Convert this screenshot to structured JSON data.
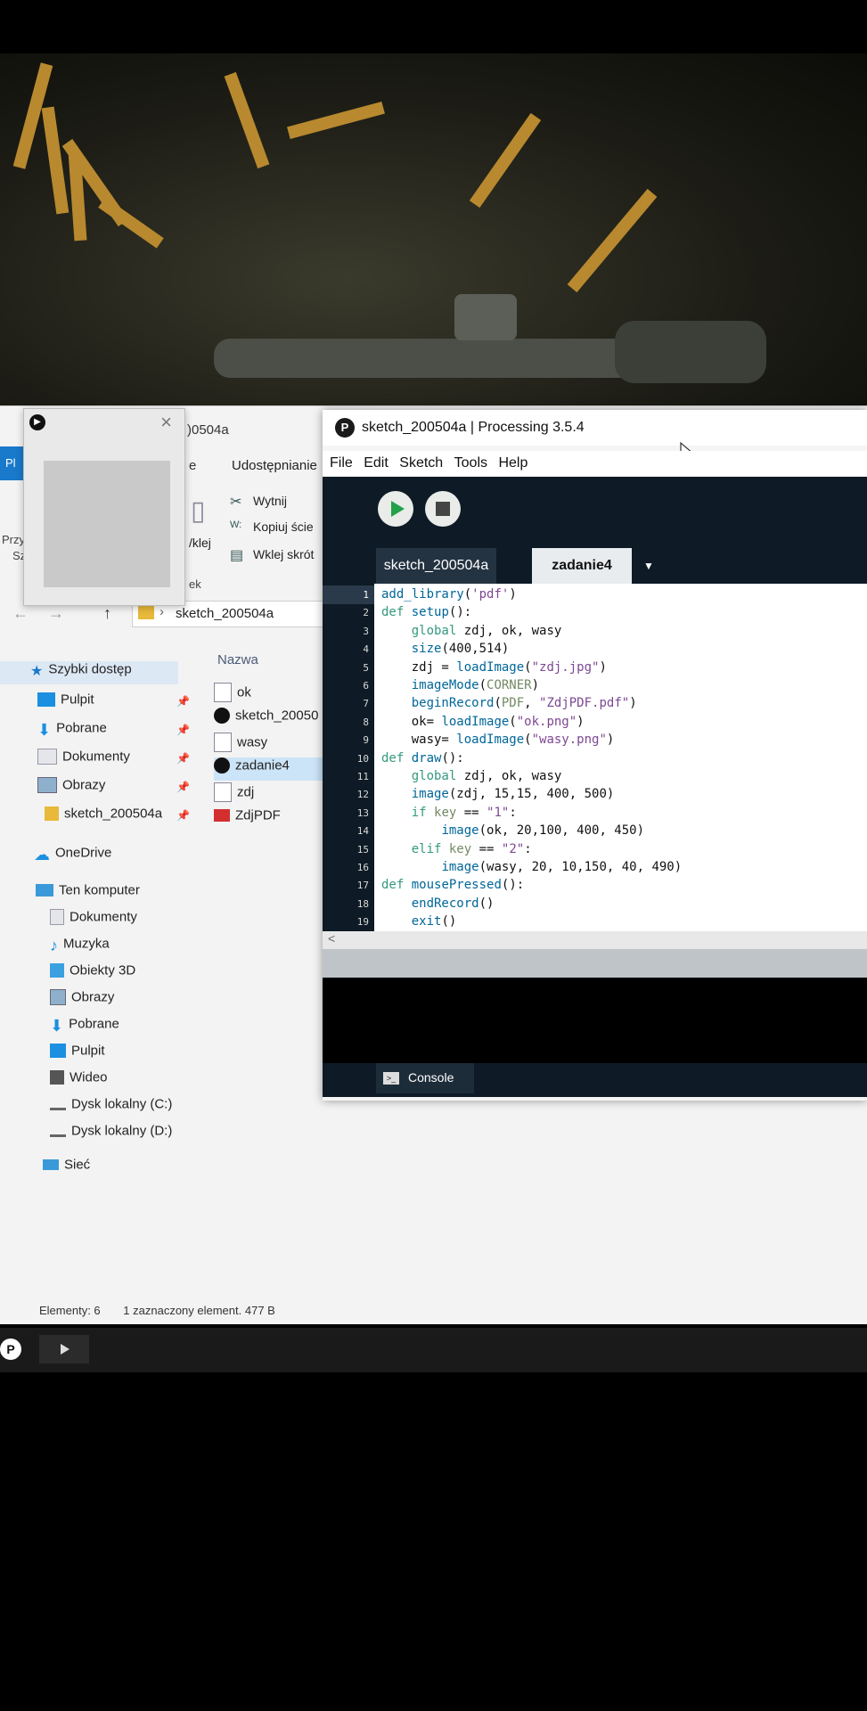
{
  "explorer": {
    "title_partial": ")0504a",
    "ribbon": {
      "file_tab_partial": "Pl",
      "home_tab_partial": "e",
      "share_tab": "Udostępnianie",
      "cut": "Wytnij",
      "copy_path": "Kopiuj ście",
      "paste_shortcut": "Wklej skrót",
      "paste_partial": "/klej",
      "left_partial_1": "Przy",
      "left_partial_2": "Sz",
      "left_partial_3": "ek"
    },
    "address": {
      "path": "sketch_200504a",
      "separator": "›"
    },
    "nav": {
      "quick_access": "Szybki dostęp",
      "items": [
        {
          "label": "Pulpit",
          "pinned": true
        },
        {
          "label": "Pobrane",
          "pinned": true
        },
        {
          "label": "Dokumenty",
          "pinned": true
        },
        {
          "label": "Obrazy",
          "pinned": true
        },
        {
          "label": "sketch_200504a",
          "pinned": true
        }
      ],
      "onedrive": "OneDrive",
      "this_pc": "Ten komputer",
      "pc_items": [
        "Dokumenty",
        "Muzyka",
        "Obiekty 3D",
        "Obrazy",
        "Pobrane",
        "Pulpit",
        "Wideo",
        "Dysk lokalny (C:)",
        "Dysk lokalny (D:)"
      ],
      "network": "Sieć"
    },
    "column_name": "Nazwa",
    "files": [
      {
        "name": "ok",
        "type": "image"
      },
      {
        "name": "sketch_20050",
        "type": "processing"
      },
      {
        "name": "wasy",
        "type": "image"
      },
      {
        "name": "zadanie4",
        "type": "processing",
        "selected": true
      },
      {
        "name": "zdj",
        "type": "image"
      },
      {
        "name": "ZdjPDF",
        "type": "pdf"
      }
    ],
    "status": {
      "count": "Elementy: 6",
      "selected": "1 zaznaczony element. 477 B"
    }
  },
  "processing": {
    "title": "sketch_200504a | Processing 3.5.4",
    "menu": [
      "File",
      "Edit",
      "Sketch",
      "Tools",
      "Help"
    ],
    "tabs": [
      "sketch_200504a",
      "zadanie4"
    ],
    "tab_menu_glyph": "▼",
    "current_line": 1,
    "scroll_glyph": "<",
    "console_label": "Console",
    "code": [
      "add_library('pdf')",
      "def setup():",
      "    global zdj, ok, wasy",
      "    size(400,514)",
      "    zdj = loadImage(\"zdj.jpg\")",
      "    imageMode(CORNER)",
      "    beginRecord(PDF, \"ZdjPDF.pdf\")",
      "    ok= loadImage(\"ok.png\")",
      "    wasy= loadImage(\"wasy.png\")",
      "def draw():",
      "    global zdj, ok, wasy",
      "    image(zdj, 15,15, 400, 500)",
      "    if key == \"1\":",
      "        image(ok, 20,100, 400, 450)",
      "    elif key == \"2\":",
      "        image(wasy, 20, 10,150, 40, 490)",
      "def mousePressed():",
      "    endRecord()",
      "    exit()"
    ]
  },
  "colors": {
    "processing_dark": "#0e1b26",
    "run_green": "#23a04a",
    "explorer_bg": "#f3f3f3",
    "selection_blue": "#cce4f7"
  }
}
